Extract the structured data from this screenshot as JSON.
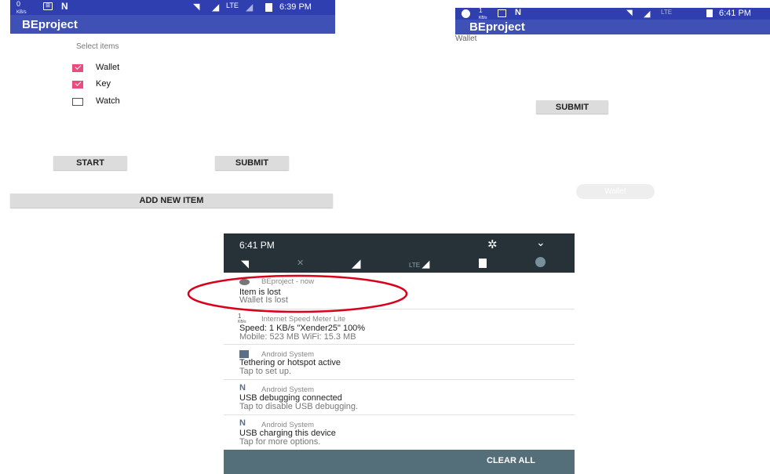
{
  "left": {
    "status": {
      "speed": "0",
      "speed_unit": "KB/s",
      "time": "6:39 PM",
      "network": "LTE"
    },
    "app_title": "BEproject",
    "select_label": "Select items",
    "items": [
      {
        "label": "Wallet",
        "checked": true
      },
      {
        "label": "Key",
        "checked": true
      },
      {
        "label": "Watch",
        "checked": false
      }
    ],
    "start_label": "START",
    "submit_label": "SUBMIT",
    "add_label": "ADD NEW ITEM"
  },
  "right": {
    "status": {
      "speed": "1",
      "speed_unit": "KB/s",
      "time": "6:41 PM",
      "network": "LTE"
    },
    "app_title": "BEproject",
    "lost_item": "Wallet",
    "submit_label": "SUBMIT",
    "toast": "Wallet"
  },
  "shade": {
    "time": "6:41 PM",
    "quick_tile_net": "LTE",
    "notifications": [
      {
        "app": "BEproject - now",
        "title": "Item is lost",
        "body": "Wallet Is lost"
      },
      {
        "app_prefix": "1",
        "app_unit": "KB/s",
        "app": "Internet Speed Meter Lite",
        "title": "Speed: 1 KB/s  \"Xender25\" 100%",
        "body": "Mobile: 523 MB   WiFi: 15.3 MB"
      },
      {
        "app": "Android System",
        "title": "Tethering or hotspot active",
        "body": "Tap to set up."
      },
      {
        "app": "Android System",
        "title": "USB debugging connected",
        "body": "Tap to disable USB debugging."
      },
      {
        "app": "Android System",
        "title": "USB charging this device",
        "body": "Tap for more options."
      }
    ],
    "clear_all": "CLEAR ALL"
  },
  "colors": {
    "primary": "#3f51b5",
    "accent": "#ec4c7d",
    "highlight": "#d9001b",
    "shade_dark": "#263238"
  }
}
